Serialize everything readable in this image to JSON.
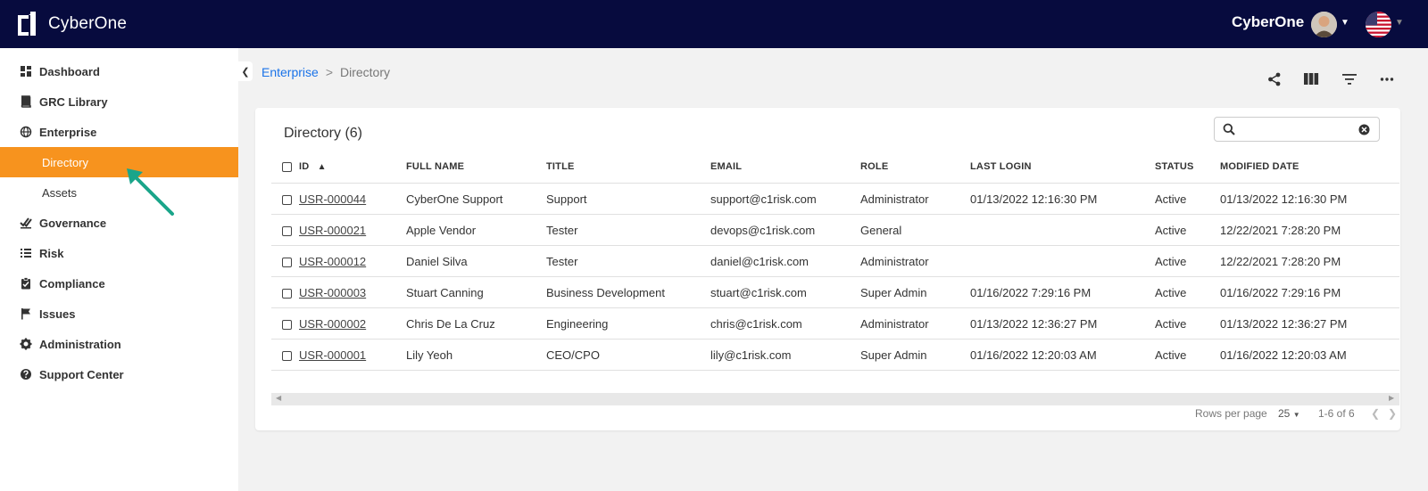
{
  "header": {
    "logo_text": "CyberOne",
    "org_name": "CyberOne"
  },
  "sidebar": {
    "items": [
      {
        "label": "Dashboard",
        "icon": "dashboard-icon"
      },
      {
        "label": "GRC Library",
        "icon": "book-icon"
      },
      {
        "label": "Enterprise",
        "icon": "globe-icon"
      },
      {
        "label": "Directory",
        "icon": "",
        "active": true
      },
      {
        "label": "Assets",
        "icon": ""
      },
      {
        "label": "Governance",
        "icon": "double-check-icon"
      },
      {
        "label": "Risk",
        "icon": "list-icon"
      },
      {
        "label": "Compliance",
        "icon": "clipboard-check-icon"
      },
      {
        "label": "Issues",
        "icon": "flag-icon"
      },
      {
        "label": "Administration",
        "icon": "gear-icon"
      },
      {
        "label": "Support Center",
        "icon": "help-icon"
      }
    ]
  },
  "breadcrumb": {
    "parent": "Enterprise",
    "separator": ">",
    "current": "Directory"
  },
  "table": {
    "title": "Directory (6)",
    "search_placeholder": "",
    "columns": [
      "ID",
      "FULL NAME",
      "TITLE",
      "EMAIL",
      "ROLE",
      "LAST LOGIN",
      "STATUS",
      "MODIFIED DATE"
    ],
    "rows": [
      {
        "id": "USR-000044",
        "name": "CyberOne Support",
        "title": "Support",
        "email": "support@c1risk.com",
        "role": "Administrator",
        "last_login": "01/13/2022 12:16:30 PM",
        "status": "Active",
        "modified": "01/13/2022 12:16:30 PM"
      },
      {
        "id": "USR-000021",
        "name": "Apple Vendor",
        "title": "Tester",
        "email": "devops@c1risk.com",
        "role": "General",
        "last_login": "",
        "status": "Active",
        "modified": "12/22/2021 7:28:20 PM"
      },
      {
        "id": "USR-000012",
        "name": "Daniel Silva",
        "title": "Tester",
        "email": "daniel@c1risk.com",
        "role": "Administrator",
        "last_login": "",
        "status": "Active",
        "modified": "12/22/2021 7:28:20 PM"
      },
      {
        "id": "USR-000003",
        "name": "Stuart Canning",
        "title": "Business Development",
        "email": "stuart@c1risk.com",
        "role": "Super Admin",
        "last_login": "01/16/2022 7:29:16 PM",
        "status": "Active",
        "modified": "01/16/2022 7:29:16 PM"
      },
      {
        "id": "USR-000002",
        "name": "Chris De La Cruz",
        "title": "Engineering",
        "email": "chris@c1risk.com",
        "role": "Administrator",
        "last_login": "01/13/2022 12:36:27 PM",
        "status": "Active",
        "modified": "01/13/2022 12:36:27 PM"
      },
      {
        "id": "USR-000001",
        "name": "Lily Yeoh",
        "title": "CEO/CPO",
        "email": "lily@c1risk.com",
        "role": "Super Admin",
        "last_login": "01/16/2022 12:20:03 AM",
        "status": "Active",
        "modified": "01/16/2022 12:20:03 AM"
      }
    ]
  },
  "pagination": {
    "rows_per_page_label": "Rows per page",
    "rows_per_page": "25",
    "range": "1-6 of 6"
  },
  "colors": {
    "topbar": "#070b3e",
    "active_nav": "#f7931e",
    "link": "#1a73e8",
    "arrow": "#1aa58a"
  }
}
